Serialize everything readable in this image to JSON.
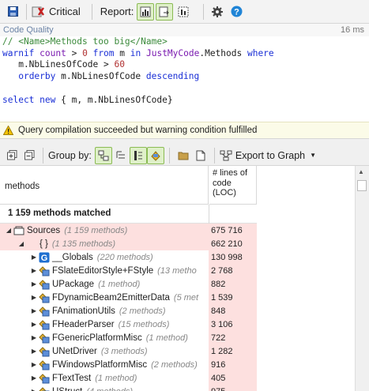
{
  "toolbar": {
    "critical_label": "Critical",
    "report_label": "Report:"
  },
  "query": {
    "title": "Code Quality",
    "time": "16 ms",
    "lines": [
      [
        {
          "t": "c",
          "v": "// <Name>Methods too big</Name>"
        }
      ],
      [
        {
          "t": "k",
          "v": "warnif"
        },
        {
          "t": "p",
          "v": " "
        },
        {
          "t": "n",
          "v": "count"
        },
        {
          "t": "p",
          "v": " > "
        },
        {
          "t": "num",
          "v": "0"
        },
        {
          "t": "p",
          "v": " "
        },
        {
          "t": "k",
          "v": "from"
        },
        {
          "t": "p",
          "v": " m "
        },
        {
          "t": "k",
          "v": "in"
        },
        {
          "t": "p",
          "v": " "
        },
        {
          "t": "n",
          "v": "JustMyCode"
        },
        {
          "t": "p",
          "v": ".Methods "
        },
        {
          "t": "k",
          "v": "where"
        }
      ],
      [
        {
          "t": "p",
          "v": "   m.NbLinesOfCode > "
        },
        {
          "t": "num",
          "v": "60"
        }
      ],
      [
        {
          "t": "p",
          "v": "   "
        },
        {
          "t": "k",
          "v": "orderby"
        },
        {
          "t": "p",
          "v": " m.NbLinesOfCode "
        },
        {
          "t": "k",
          "v": "descending"
        }
      ],
      [
        {
          "t": "p",
          "v": ""
        }
      ],
      [
        {
          "t": "k",
          "v": "select"
        },
        {
          "t": "p",
          "v": " "
        },
        {
          "t": "k",
          "v": "new"
        },
        {
          "t": "p",
          "v": " { m, m.NbLinesOfCode}"
        }
      ]
    ]
  },
  "warning": {
    "text": "Query compilation succeeded but warning condition fulfilled"
  },
  "toolbar2": {
    "group_by_label": "Group by:",
    "export_label": "Export to Graph"
  },
  "grid": {
    "col_methods": "methods",
    "col_loc": "# lines of\ncode\n(LOC)",
    "matched_label": "1 159 methods matched",
    "rows": [
      {
        "level": 0,
        "icon": "folder-icon",
        "name": "Sources",
        "sub": "(1 159 methods)",
        "loc": "675 716",
        "pink_name": true
      },
      {
        "level": 1,
        "icon": "namespace-icon",
        "name": "{ }",
        "sub": "(1 135 methods)",
        "loc": "662 210",
        "pink_name": true
      },
      {
        "level": 2,
        "icon": "globals-icon",
        "name": "__Globals",
        "sub": "(220 methods)",
        "loc": "130 998",
        "pink_name": false
      },
      {
        "level": 2,
        "icon": "class-icon",
        "name": "FSlateEditorStyle+FStyle",
        "sub": "(13 metho",
        "loc": "2 768",
        "pink_name": false
      },
      {
        "level": 2,
        "icon": "class-icon",
        "name": "UPackage",
        "sub": "(1 method)",
        "loc": "882",
        "pink_name": false
      },
      {
        "level": 2,
        "icon": "class-icon",
        "name": "FDynamicBeam2EmitterData",
        "sub": "(5 met",
        "loc": "1 539",
        "pink_name": false
      },
      {
        "level": 2,
        "icon": "class-icon",
        "name": "FAnimationUtils",
        "sub": "(2 methods)",
        "loc": "848",
        "pink_name": false
      },
      {
        "level": 2,
        "icon": "class-icon",
        "name": "FHeaderParser",
        "sub": "(15 methods)",
        "loc": "3 106",
        "pink_name": false
      },
      {
        "level": 2,
        "icon": "class-icon",
        "name": "FGenericPlatformMisc",
        "sub": "(1 method)",
        "loc": "722",
        "pink_name": false
      },
      {
        "level": 2,
        "icon": "class-icon",
        "name": "UNetDriver",
        "sub": "(3 methods)",
        "loc": "1 282",
        "pink_name": false
      },
      {
        "level": 2,
        "icon": "class-icon",
        "name": "FWindowsPlatformMisc",
        "sub": "(2 methods)",
        "loc": "916",
        "pink_name": false
      },
      {
        "level": 2,
        "icon": "class-icon",
        "name": "FTextTest",
        "sub": "(1 method)",
        "loc": "405",
        "pink_name": false
      },
      {
        "level": 2,
        "icon": "class-icon",
        "name": "UStruct",
        "sub": "(4 methods)",
        "loc": "975",
        "pink_name": false
      }
    ]
  }
}
